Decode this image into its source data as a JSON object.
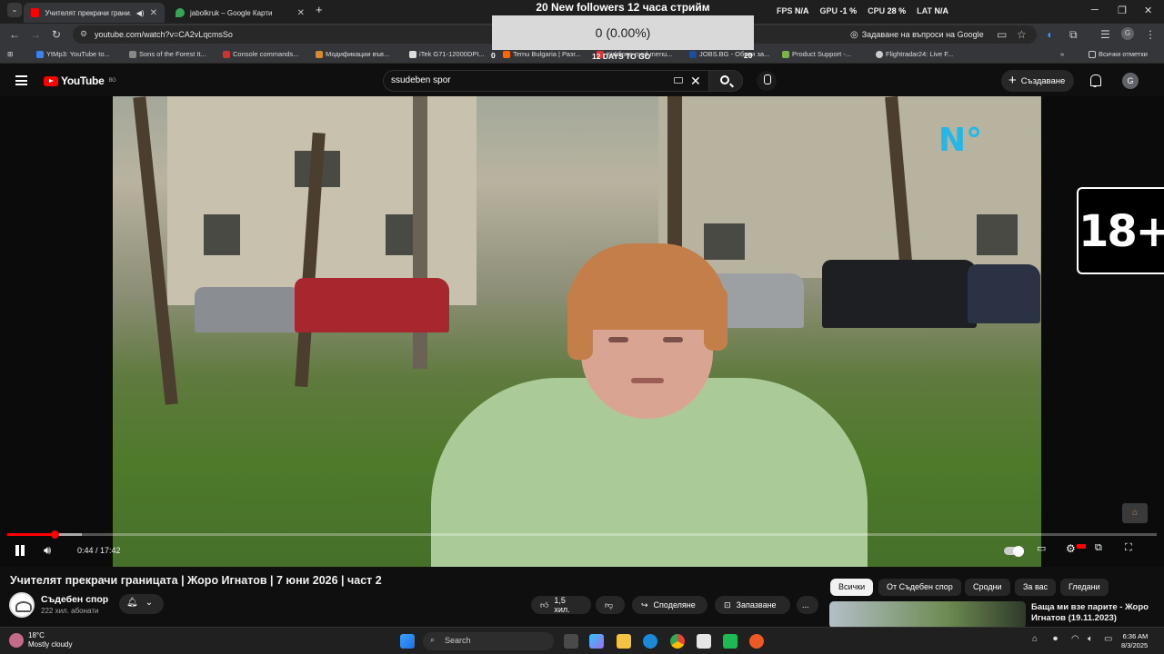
{
  "browser": {
    "tabs": [
      {
        "title": "Учителят прекрачи грани...",
        "active": true
      },
      {
        "title": "jabolkruk – Google Карти",
        "active": false
      }
    ],
    "url": "youtube.com/watch?v=CA2vLqcmsSo",
    "ask_google": "Задаване на въпроси на Google",
    "profile_letter": "G",
    "bookmarks": [
      "YtMp3: YouTube to...",
      "Sons of the Forest It...",
      "Console commands...",
      "Модификации във...",
      "iTek G71-12000DPI...",
      "Temu Bulgaria | Разг...",
      "Kiddions mod menu...",
      "JOBS.BG - Обяви за...",
      "Product Support -...",
      "Flightradar24: Live F..."
    ],
    "all_bookmarks": "Всички отметки",
    "overflow": "»"
  },
  "overlay": {
    "follow_banner": "20 New followers 12 часа стрийм",
    "goal_value": "0 (0.00%)",
    "goal_start": "0",
    "goal_days": "12 DAYS TO GO",
    "goal_end": "20",
    "hud": [
      {
        "label": "FPS",
        "value": "N/A"
      },
      {
        "label": "GPU",
        "value": "-1 %"
      },
      {
        "label": "CPU",
        "value": "28 %"
      },
      {
        "label": "LAT",
        "value": "N/A"
      }
    ]
  },
  "youtube": {
    "logo_text": "YouTube",
    "region": "BG",
    "search_value": "ssudeben spor",
    "create_label": "Създаване",
    "avatar_letter": "G",
    "age_badge": "18+",
    "channel_logo": "N°",
    "player": {
      "time": "0:44 / 17:42",
      "progress_fraction": 0.0414,
      "buffered_fraction": 0.065
    },
    "video_title": "Учителят прекрачи границата | Жоро Игнатов | 7 юни 2026 | част 2",
    "channel_name": "Съдебен спор",
    "subscribers": "222 хил. абонати",
    "likes": "1,5 хил.",
    "share_label": "Споделяне",
    "save_label": "Запазване",
    "more_label": "...",
    "chips": [
      "Всички",
      "От Съдебен спор",
      "Сродни",
      "За вас",
      "Гледани"
    ],
    "recommended_title": "Баща ми взе парите - Жоро Игнатов (19.11.2023)"
  },
  "taskbar": {
    "temperature": "18°C",
    "weather": "Mostly cloudy",
    "search_label": "Search",
    "time": "6:36 AM",
    "date": "8/3/2025"
  }
}
